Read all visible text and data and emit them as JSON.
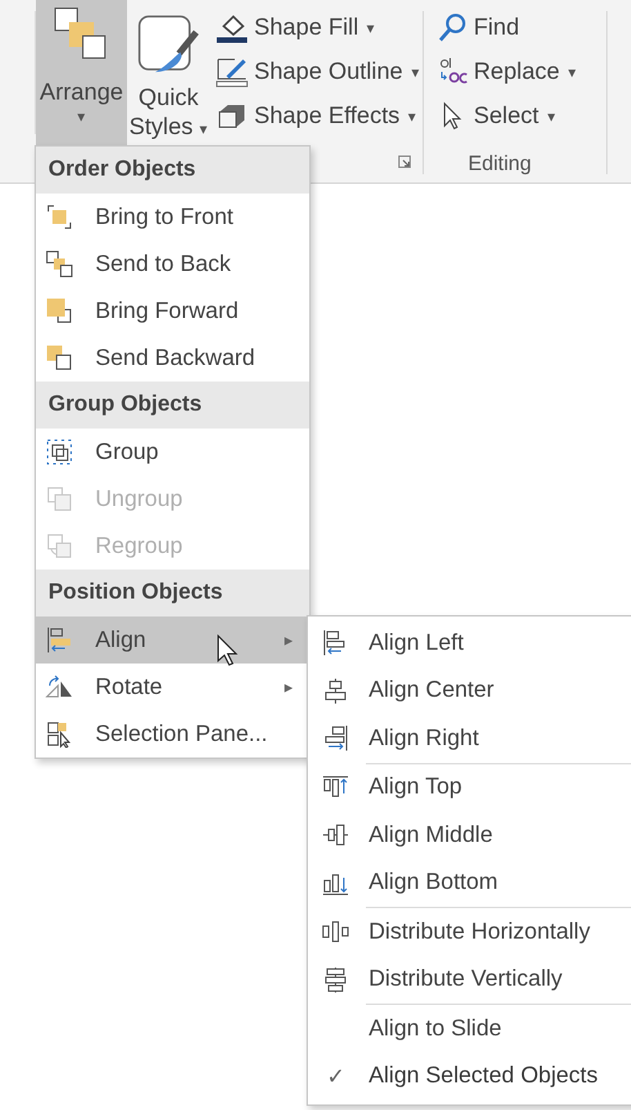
{
  "ribbon": {
    "arrange": {
      "label": "Arrange",
      "caret": "▾",
      "pressed": true
    },
    "quick_styles": {
      "label_top": "Quick",
      "label_bottom": "Styles",
      "caret": "▾"
    },
    "shape_buttons": [
      {
        "label": "Shape Fill",
        "kind": "fill",
        "caret": "▾"
      },
      {
        "label": "Shape Outline",
        "kind": "outline",
        "caret": "▾"
      },
      {
        "label": "Shape Effects",
        "kind": "effects",
        "caret": "▾"
      }
    ],
    "editing_buttons": [
      {
        "label": "Find",
        "kind": "find"
      },
      {
        "label": "Replace",
        "kind": "replace",
        "caret": "▾"
      },
      {
        "label": "Select",
        "kind": "select",
        "caret": "▾"
      }
    ],
    "editing_label": "Editing"
  },
  "menu": {
    "sections": [
      {
        "header": "Order Objects",
        "items": [
          {
            "label": "Bring to Front",
            "kind": "front",
            "disabled": false,
            "selected": false
          },
          {
            "label": "Send to Back",
            "kind": "back",
            "disabled": false,
            "selected": false
          },
          {
            "label": "Bring Forward",
            "kind": "forward",
            "disabled": false,
            "selected": false
          },
          {
            "label": "Send Backward",
            "kind": "backward",
            "disabled": false,
            "selected": false
          }
        ]
      },
      {
        "header": "Group Objects",
        "items": [
          {
            "label": "Group",
            "kind": "group",
            "disabled": false,
            "selected": false
          },
          {
            "label": "Ungroup",
            "kind": "ungroup",
            "disabled": true,
            "selected": false
          },
          {
            "label": "Regroup",
            "kind": "regroup",
            "disabled": true,
            "selected": false
          }
        ]
      },
      {
        "header": "Position Objects",
        "items": [
          {
            "label": "Align",
            "kind": "align",
            "disabled": false,
            "selected": true,
            "submenu": "▸"
          },
          {
            "label": "Rotate",
            "kind": "rotate",
            "disabled": false,
            "selected": false,
            "submenu": "▸"
          },
          {
            "label": "Selection Pane...",
            "kind": "pane",
            "disabled": false,
            "selected": false
          }
        ]
      }
    ]
  },
  "submenu": {
    "groups": [
      [
        {
          "label": "Align Left",
          "kind": "left",
          "checked": false
        },
        {
          "label": "Align Center",
          "kind": "center",
          "checked": false
        },
        {
          "label": "Align Right",
          "kind": "right",
          "checked": false
        }
      ],
      [
        {
          "label": "Align Top",
          "kind": "top",
          "checked": false
        },
        {
          "label": "Align Middle",
          "kind": "middle",
          "checked": false
        },
        {
          "label": "Align Bottom",
          "kind": "bottom",
          "checked": false
        }
      ],
      [
        {
          "label": "Distribute Horizontally",
          "kind": "distribute-h",
          "checked": false
        },
        {
          "label": "Distribute Vertically",
          "kind": "distribute-v",
          "checked": false
        }
      ],
      [
        {
          "label": "Align to Slide",
          "checked": false
        },
        {
          "label": "Align Selected Objects",
          "checked": true
        }
      ]
    ],
    "check_mark": "✓"
  }
}
